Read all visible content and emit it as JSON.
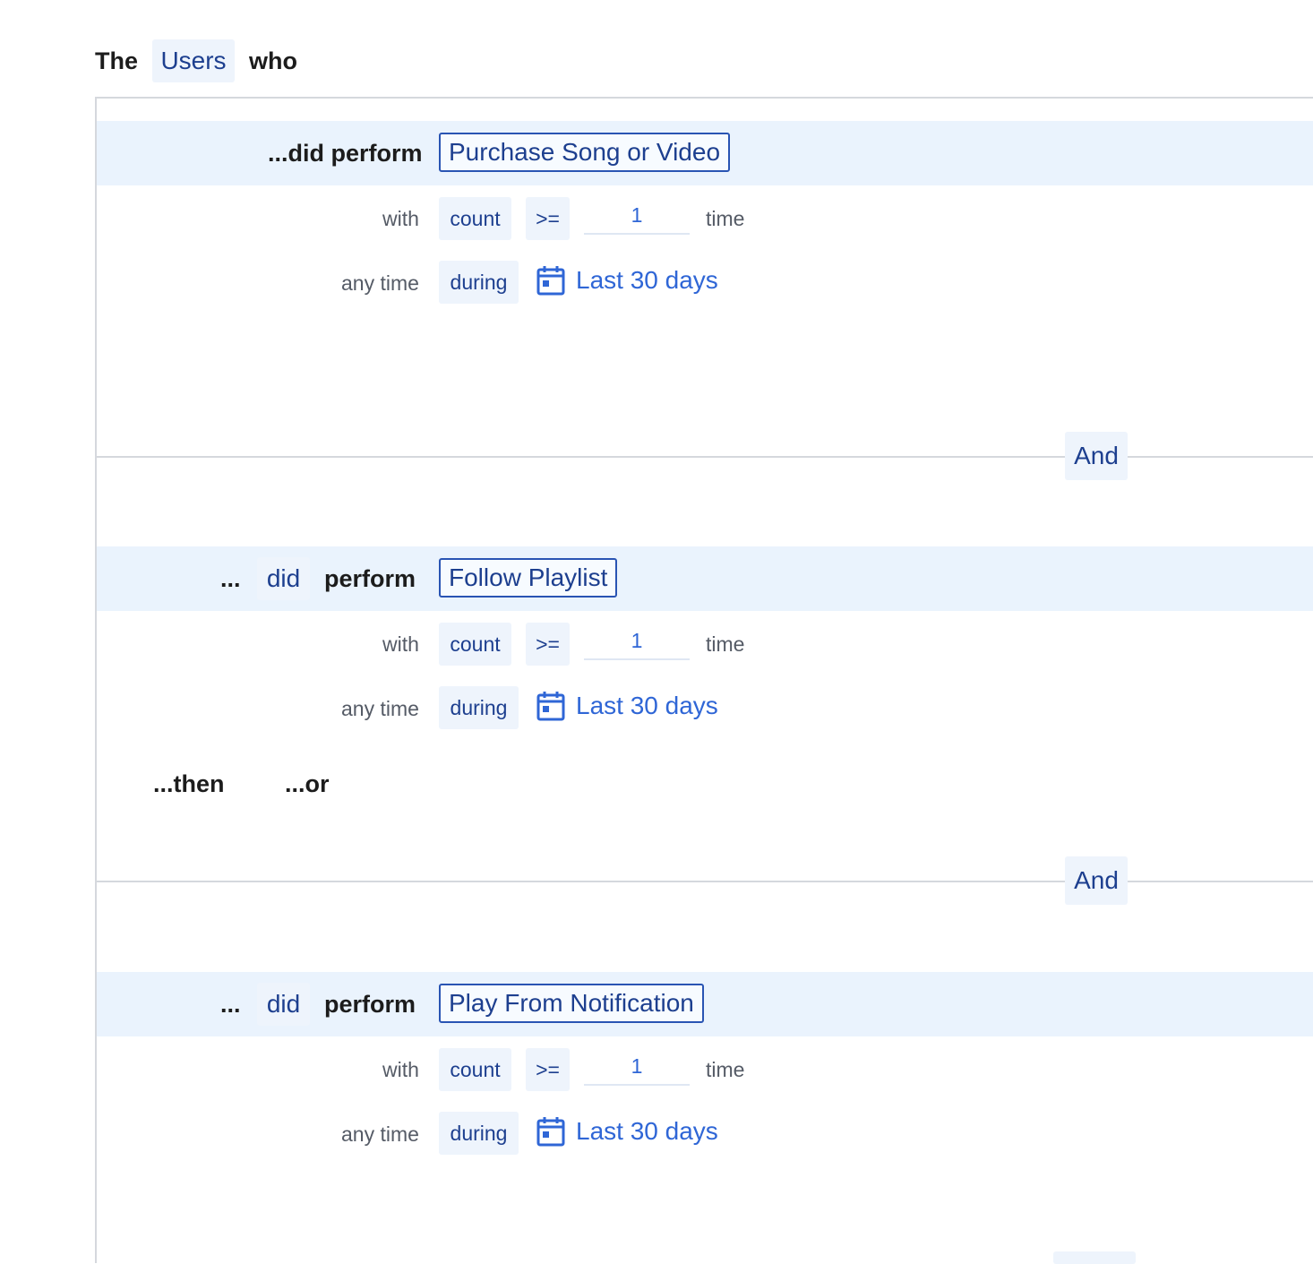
{
  "header": {
    "the": "The",
    "entity": "Users",
    "who": "who"
  },
  "conditions": [
    {
      "prefix_label": "...did perform",
      "event": "Purchase Song or Video",
      "with_label": "with",
      "aggregate": "count",
      "operator": ">=",
      "value": "1",
      "unit": "time",
      "time_label": "any time",
      "time_mode": "during",
      "date_range": "Last 30 days"
    },
    {
      "dots": "...",
      "did": "did",
      "perform": "perform",
      "event": "Follow Playlist",
      "with_label": "with",
      "aggregate": "count",
      "operator": ">=",
      "value": "1",
      "unit": "time",
      "time_label": "any time",
      "time_mode": "during",
      "date_range": "Last 30 days",
      "then_label": "...then",
      "or_label": "...or"
    },
    {
      "dots": "...",
      "did": "did",
      "perform": "perform",
      "event": "Play From Notification",
      "with_label": "with",
      "aggregate": "count",
      "operator": ">=",
      "value": "1",
      "unit": "time",
      "time_label": "any time",
      "time_mode": "during",
      "date_range": "Last 30 days"
    }
  ],
  "connectors": [
    "And",
    "And"
  ],
  "colors": {
    "accent": "#2f66d6",
    "chip_bg": "#eef4fc",
    "band_bg": "#eaf3fd",
    "chip_text": "#1d3f8f"
  },
  "icons": {
    "date": "calendar-icon"
  }
}
